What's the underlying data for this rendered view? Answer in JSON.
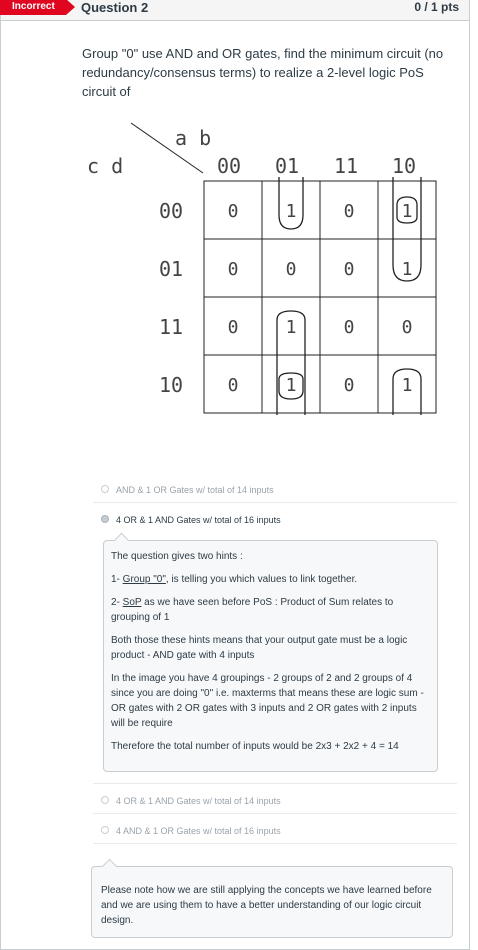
{
  "header": {
    "status_label": "Incorrect",
    "title": "Question 2",
    "points": "0 / 1 pts"
  },
  "question": {
    "text": "Group \"0\"  use AND and OR gates, find the minimum circuit (no redundancy/consensus terms) to realize a 2-level logic PoS circuit of"
  },
  "kmap": {
    "col_vars": "a b",
    "row_vars": "c d",
    "col_labels": [
      "00",
      "01",
      "11",
      "10"
    ],
    "row_labels": [
      "00",
      "01",
      "11",
      "10"
    ],
    "cells": [
      [
        "0",
        "1",
        "0",
        "1"
      ],
      [
        "0",
        "0",
        "0",
        "1"
      ],
      [
        "0",
        "1",
        "0",
        "0"
      ],
      [
        "0",
        "1",
        "0",
        "1"
      ]
    ]
  },
  "answers": [
    {
      "label": "AND & 1 OR Gates w/ total of 14 inputs",
      "selected": false
    },
    {
      "label": "4 OR & 1 AND Gates w/ total of 16 inputs",
      "selected": true
    },
    {
      "label": "4 OR & 1 AND Gates w/ total of 14 inputs",
      "selected": false
    },
    {
      "label": "4 AND & 1 OR Gates w/ total of 16 inputs",
      "selected": false
    }
  ],
  "comment1": {
    "p1": "The question gives two hints :",
    "p2_prefix": "1- ",
    "p2_link": "Group \"0\"",
    "p2_rest": ", is telling you which values to link together.",
    "p3_prefix": "2- ",
    "p3_link": "SoP",
    "p3_rest": " as we have seen before PoS :  Product of Sum relates to grouping of 1",
    "p4": "Both those these hints means that your output gate must be a logic product - AND gate with 4 inputs",
    "p5": "In the image you have 4 groupings - 2 groups of 2 and 2 groups of 4 since you are doing \"0\" i.e. maxterms that means these are logic sum - OR gates  with 2 OR gates with 3 inputs and 2 OR gates with 2 inputs will be require",
    "p6": "Therefore the total number of inputs would be 2x3 + 2x2 + 4 = 14"
  },
  "comment2": {
    "text": "Please note how we are still applying the concepts we have learned before and we are using them to have a better understanding of our logic circuit design."
  }
}
